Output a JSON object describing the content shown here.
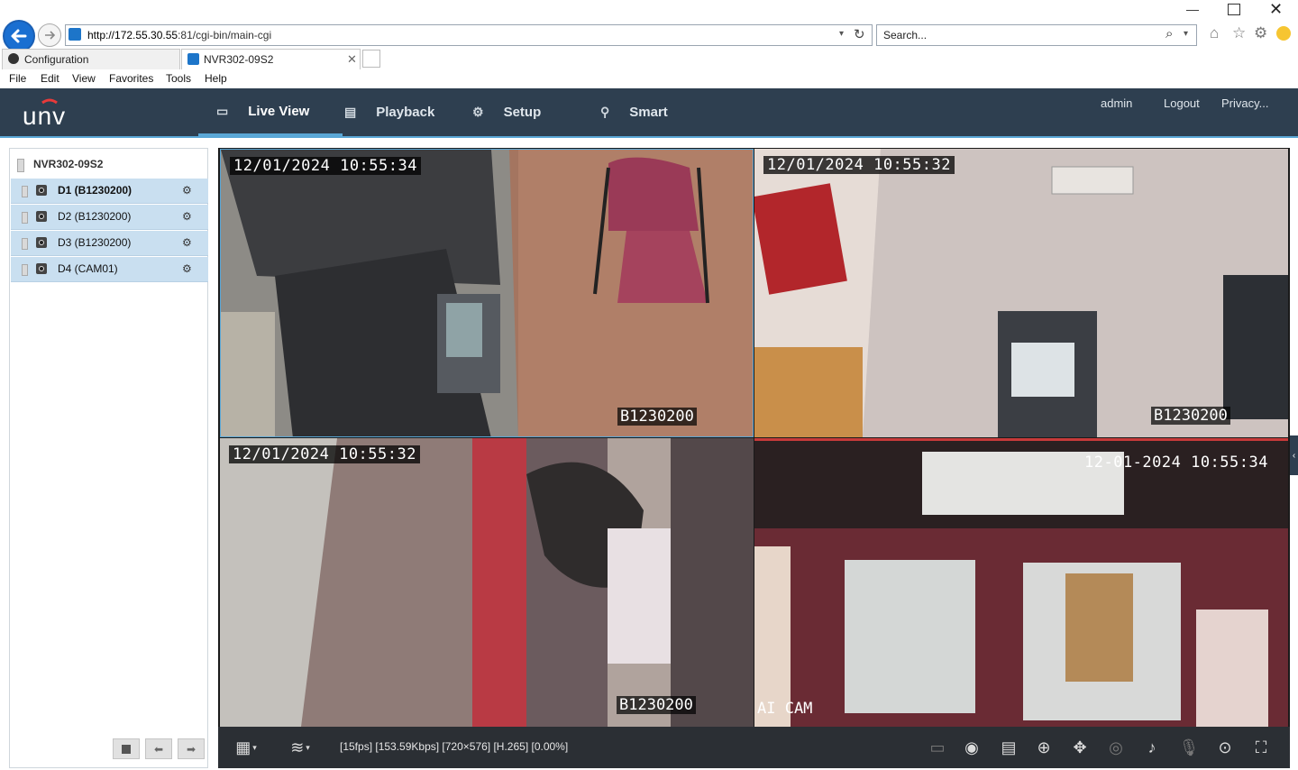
{
  "browser": {
    "url_host": "http://172.55.30.55",
    "url_rest": ":81/cgi-bin/main-cgi",
    "search_placeholder": "Search...",
    "tabs": [
      {
        "label": "Configuration"
      },
      {
        "label": "NVR302-09S2"
      }
    ],
    "menu": [
      "File",
      "Edit",
      "View",
      "Favorites",
      "Tools",
      "Help"
    ]
  },
  "app": {
    "logo": "UNV",
    "nav": [
      {
        "label": "Live View",
        "icon": "monitor-icon"
      },
      {
        "label": "Playback",
        "icon": "film-icon"
      },
      {
        "label": "Setup",
        "icon": "gear-icon"
      },
      {
        "label": "Smart",
        "icon": "person-icon"
      }
    ],
    "user": "admin",
    "logout": "Logout",
    "privacy": "Privacy..."
  },
  "devices": {
    "root": "NVR302-09S2",
    "channels": [
      {
        "label": "D1 (B1230200)"
      },
      {
        "label": "D2 (B1230200)"
      },
      {
        "label": "D3 (B1230200)"
      },
      {
        "label": "D4 (CAM01)"
      }
    ]
  },
  "video": {
    "cells": [
      {
        "timestamp": "12/01/2024 10:55:34",
        "name": "B1230200"
      },
      {
        "timestamp": "12/01/2024 10:55:32",
        "name": "B1230200"
      },
      {
        "timestamp": "12/01/2024 10:55:32",
        "name": "B1230200"
      },
      {
        "timestamp": "12-01-2024 10:55:34",
        "name": "AI CAM"
      }
    ]
  },
  "status": "[15fps] [153.59Kbps] [720×576] [H.265] [0.00%]"
}
